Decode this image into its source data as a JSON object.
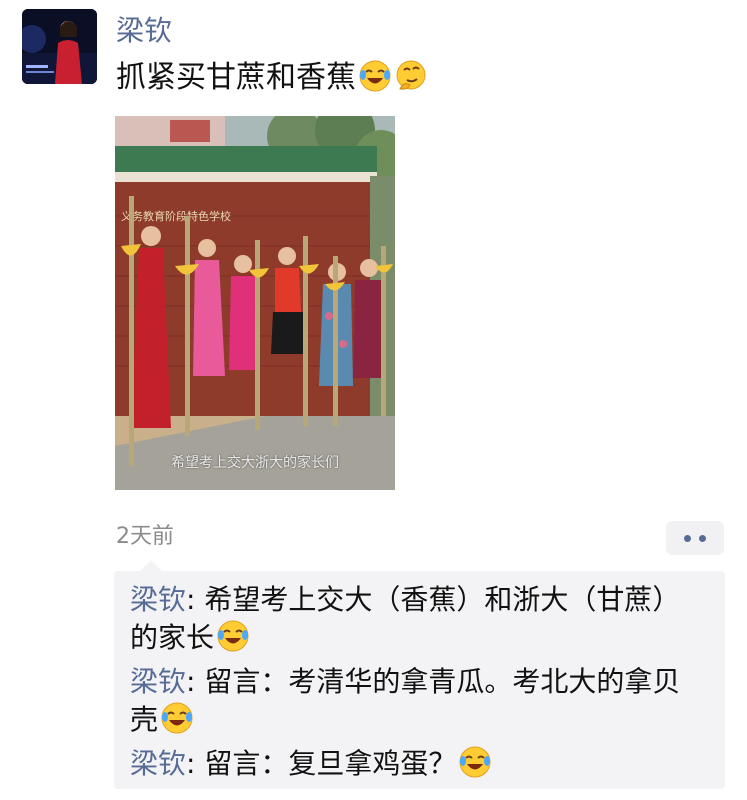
{
  "post": {
    "author": "梁钦",
    "text": "抓紧买甘蔗和香蕉",
    "text_emojis": [
      "laugh-cry-emoji",
      "thinking-emoji"
    ],
    "photo_caption": "希望考上交大浙大的家长们",
    "photo_sign": "义务教育阶段特色学校",
    "time": "2天前"
  },
  "comments": [
    {
      "name": "梁钦",
      "sep": ": ",
      "text": "希望考上交大（香蕉）和浙大（甘蔗）的家长",
      "emoji": "laugh-cry-emoji"
    },
    {
      "name": "梁钦",
      "sep": ": ",
      "text": "留言：考清华的拿青瓜。考北大的拿贝壳",
      "emoji": "laugh-cry-emoji"
    },
    {
      "name": "梁钦",
      "sep": ": ",
      "text": "留言：复旦拿鸡蛋？",
      "emoji": "laugh-cry-emoji"
    }
  ],
  "colors": {
    "link": "#576b95",
    "comment_bg": "#f3f3f5",
    "time": "#8b8b8b"
  }
}
